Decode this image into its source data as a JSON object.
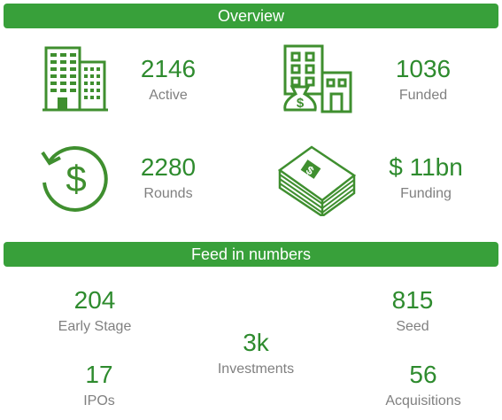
{
  "overview": {
    "title": "Overview",
    "stats": [
      {
        "icon": "office-buildings-icon",
        "value": "2146",
        "label": "Active"
      },
      {
        "icon": "building-money-bag-icon",
        "value": "1036",
        "label": "Funded"
      },
      {
        "icon": "dollar-cycle-icon",
        "value": "2280",
        "label": "Rounds"
      },
      {
        "icon": "cash-stack-icon",
        "value": "$ 11bn",
        "label": "Funding"
      }
    ]
  },
  "feed": {
    "title": "Feed in numbers",
    "early_stage": {
      "value": "204",
      "label": "Early Stage"
    },
    "seed": {
      "value": "815",
      "label": "Seed"
    },
    "investments": {
      "value": "3k",
      "label": "Investments"
    },
    "ipos": {
      "value": "17",
      "label": "IPOs"
    },
    "acquisitions": {
      "value": "56",
      "label": "Acquisitions"
    }
  },
  "colors": {
    "accent": "#38a03a",
    "icon": "#3f8f2f",
    "value_text": "#2e8b2e",
    "label_text": "#808080"
  }
}
